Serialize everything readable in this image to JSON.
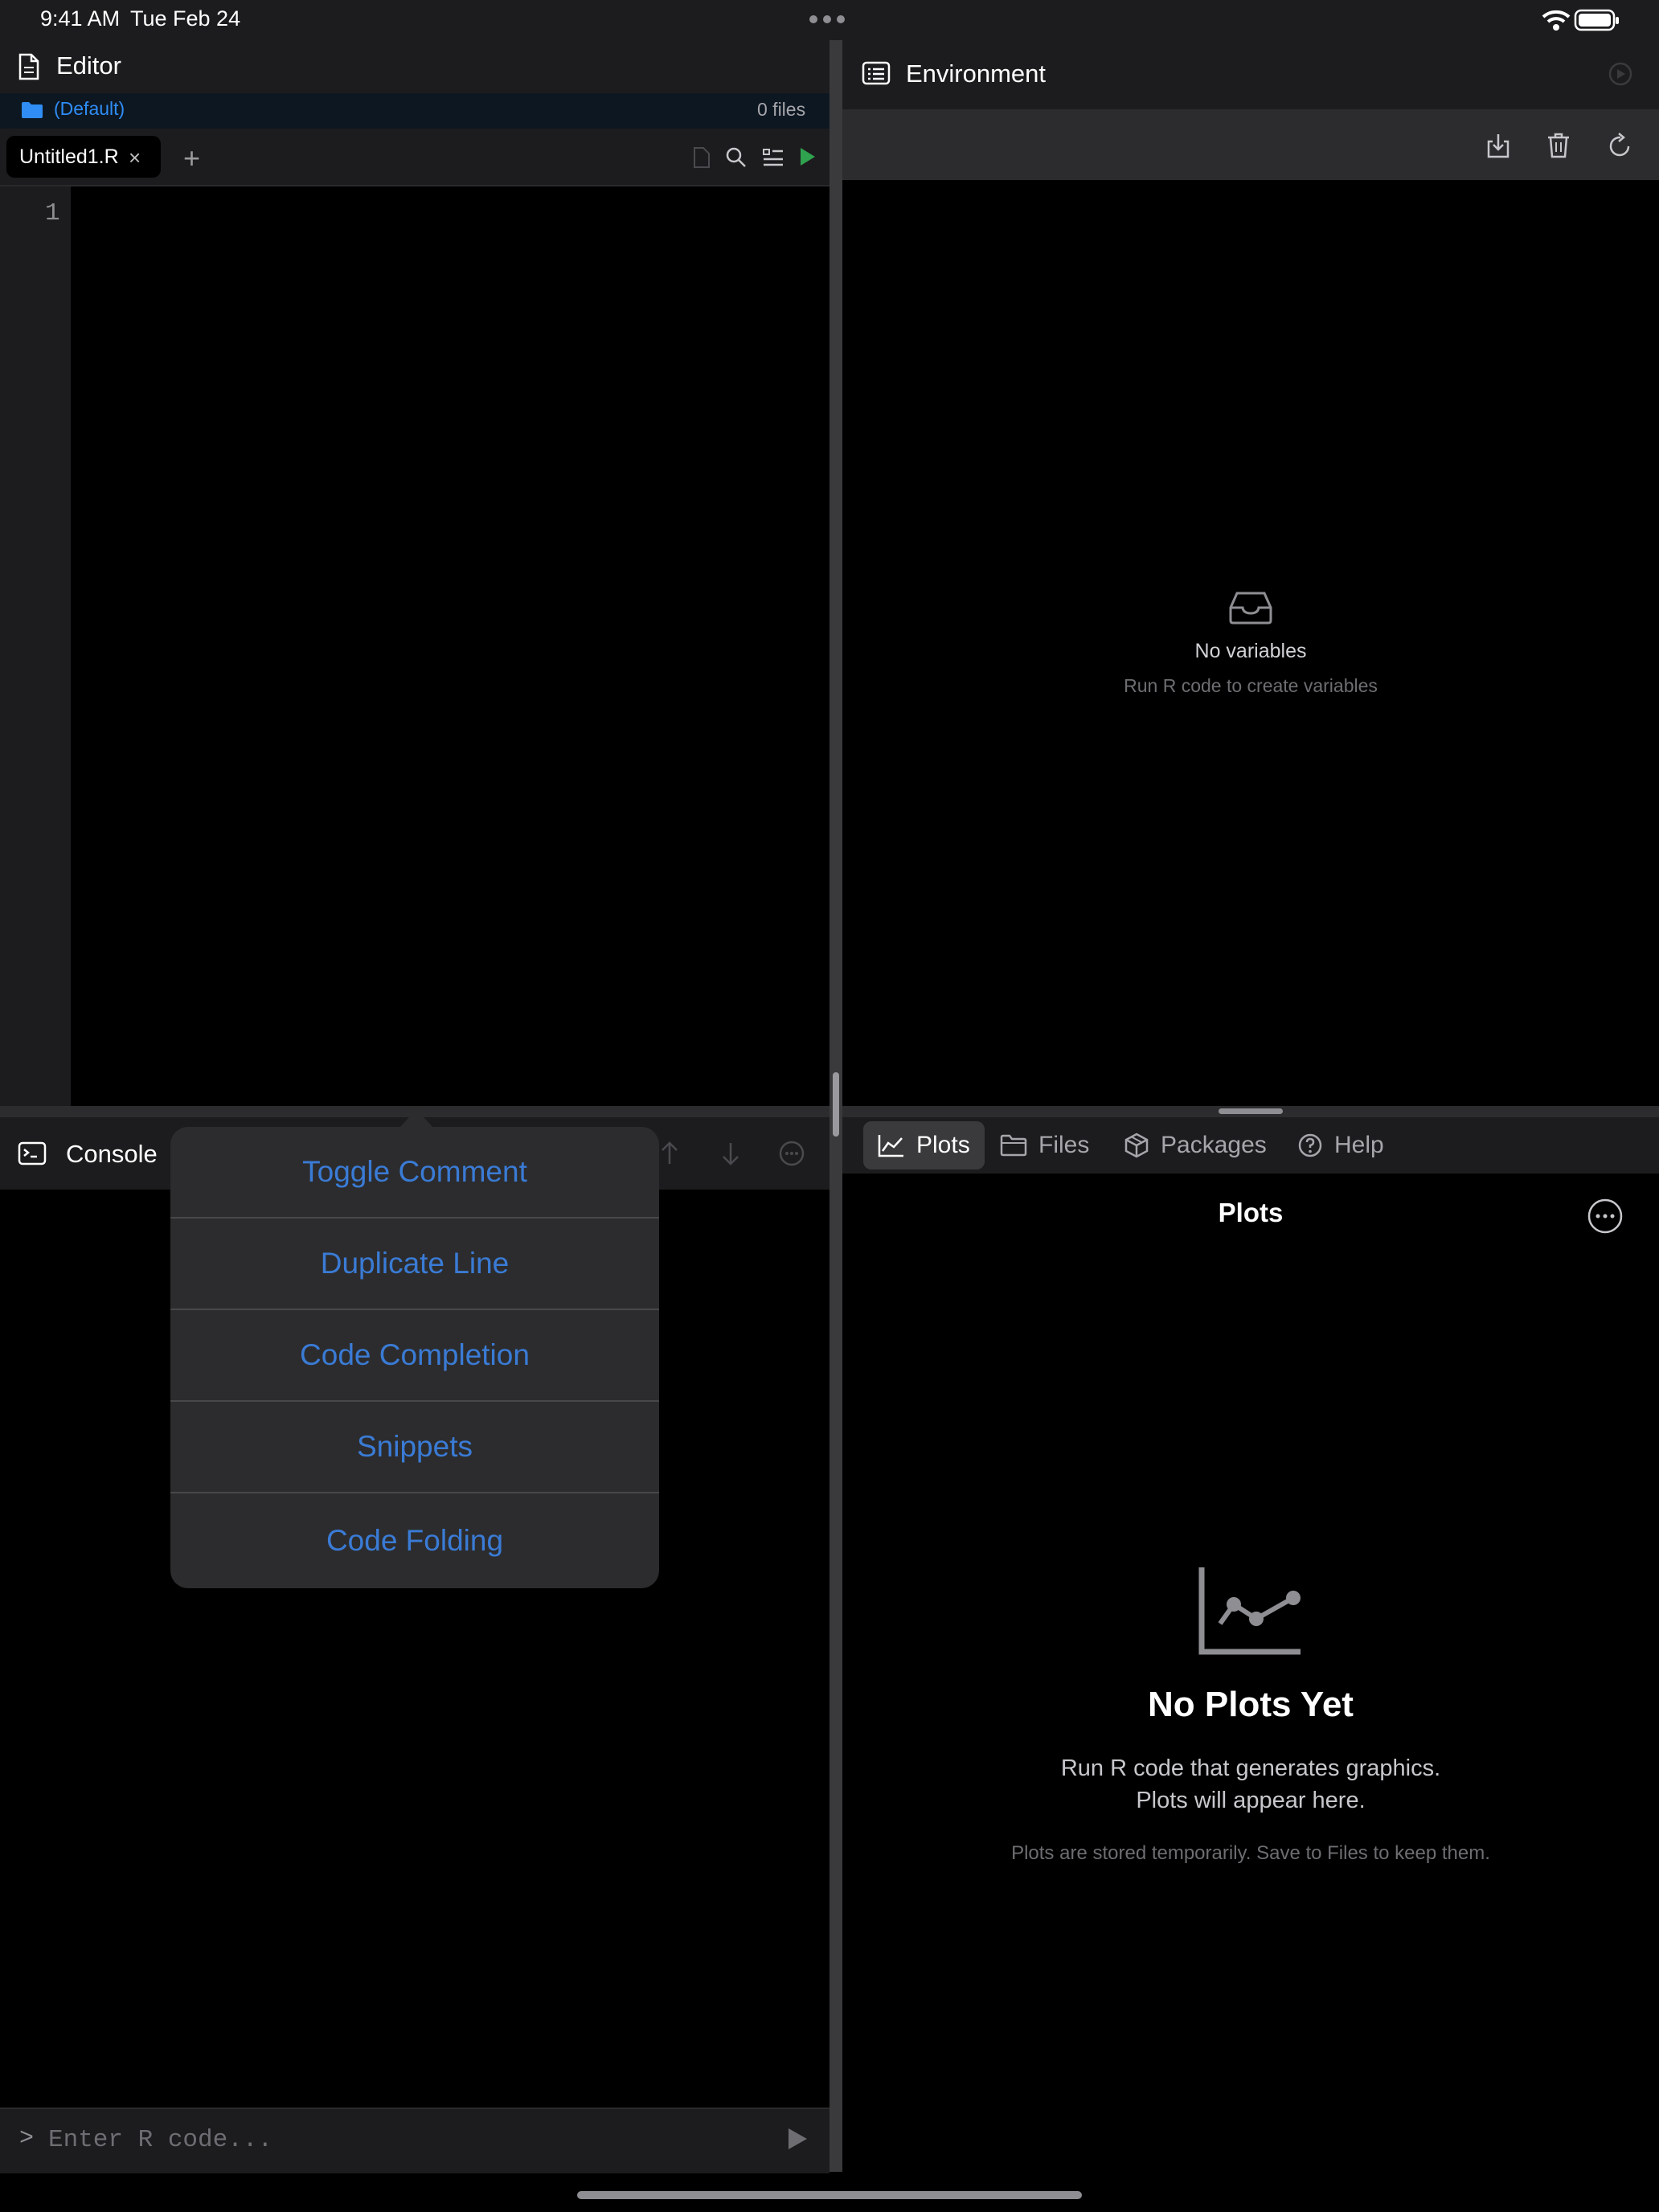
{
  "status_bar": {
    "time": "9:41 AM",
    "date": "Tue Feb 24"
  },
  "editor": {
    "title": "Editor",
    "folder": "(Default)",
    "file_count": "0 files",
    "tab": {
      "label": "Untitled1.R",
      "close": "×"
    },
    "add_tab": "+",
    "line_numbers": [
      "1"
    ]
  },
  "console": {
    "title": "Console",
    "prompt": ">",
    "input_placeholder": "Enter R code..."
  },
  "context_menu": {
    "items": [
      "Toggle Comment",
      "Duplicate Line",
      "Code Completion",
      "Snippets",
      "Code Folding"
    ]
  },
  "environment": {
    "title": "Environment",
    "empty_title": "No variables",
    "empty_subtitle": "Run R code to create variables"
  },
  "bottom_right": {
    "tabs": [
      "Plots",
      "Files",
      "Packages",
      "Help"
    ],
    "title": "Plots",
    "empty_title": "No Plots Yet",
    "empty_line1": "Run R code that generates graphics.",
    "empty_line2": "Plots will appear here.",
    "note": "Plots are stored temporarily. Save to Files to keep them."
  },
  "colors": {
    "accent": "#2f8df5",
    "menu_text": "#3a7bd5",
    "run_green": "#30a14e",
    "panel": "#1c1c1e",
    "toolbar": "#2c2c2e"
  },
  "icons": [
    "document-icon",
    "folder-icon",
    "new-file-icon",
    "search-icon",
    "list-icon",
    "run-icon",
    "terminal-icon",
    "environment-icon",
    "import-icon",
    "trash-icon",
    "refresh-icon",
    "inbox-icon",
    "plot-chart-icon",
    "files-folder-icon",
    "package-icon",
    "help-icon",
    "more-icon",
    "send-icon",
    "wifi-icon",
    "battery-icon"
  ]
}
